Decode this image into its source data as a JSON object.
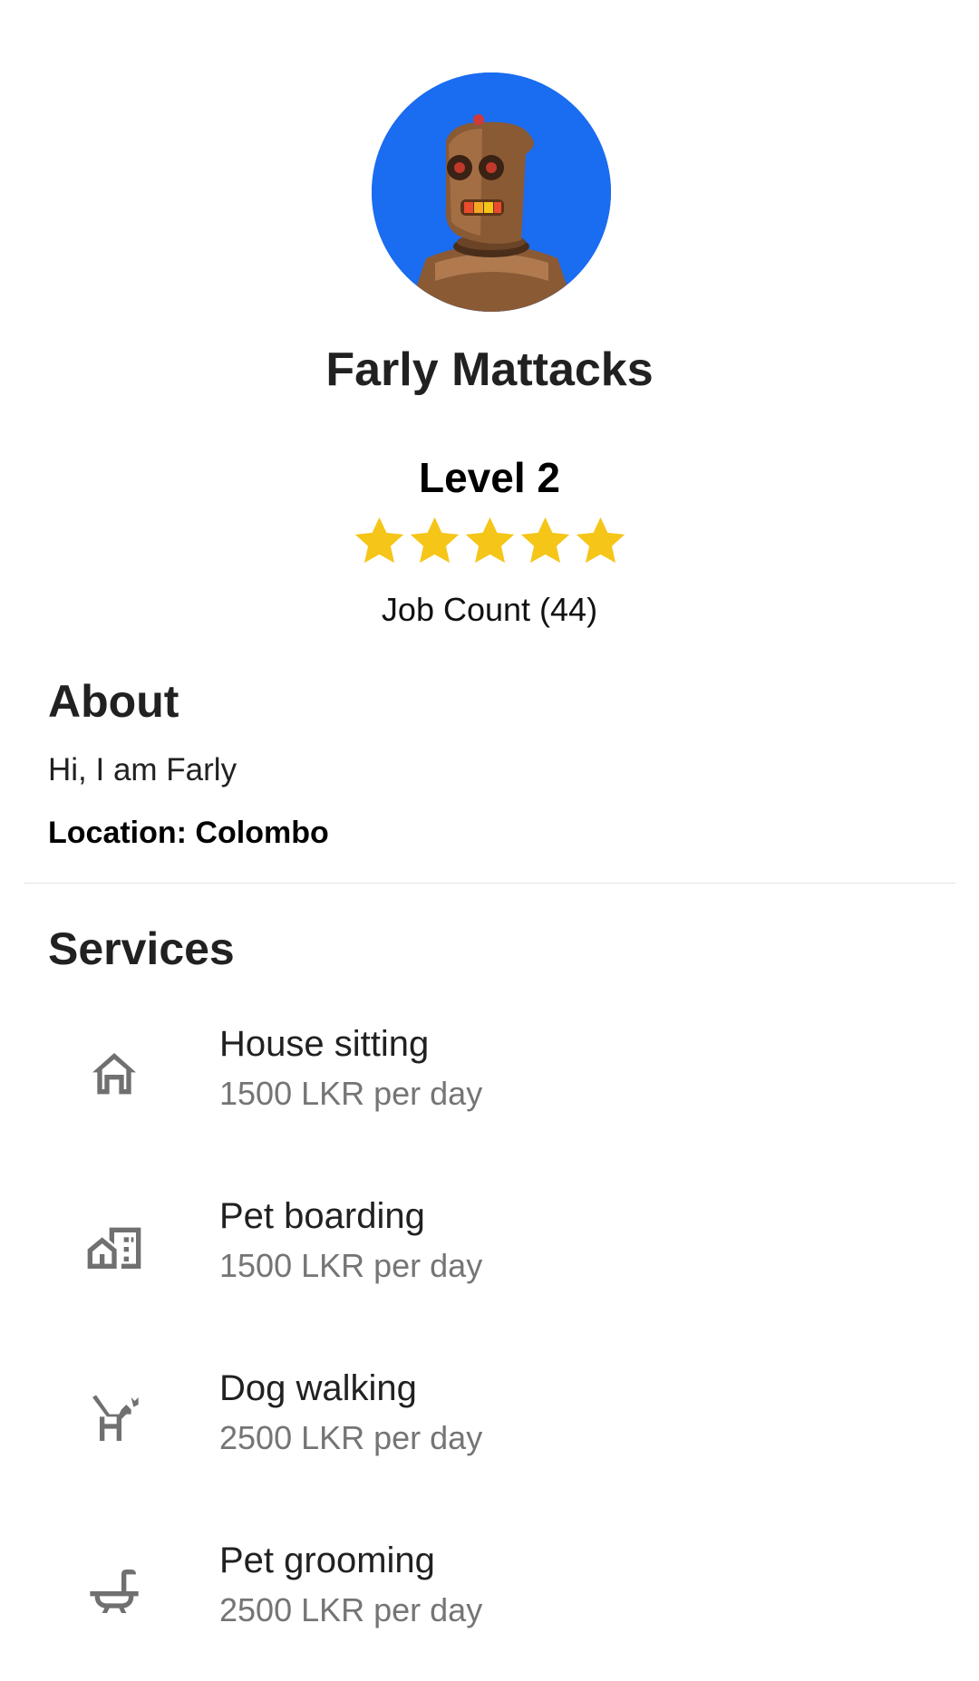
{
  "profile": {
    "name": "Farly Mattacks",
    "level": "Level 2",
    "rating": 5,
    "rating_max": 5,
    "job_count": "Job Count (44)",
    "avatar_bg": "#1a6cf0"
  },
  "about": {
    "heading": "About",
    "bio": "Hi, I am Farly",
    "location": "Location: Colombo"
  },
  "services": {
    "heading": "Services",
    "items": [
      {
        "title": "House sitting",
        "price": "1500 LKR per day",
        "icon": "house-icon"
      },
      {
        "title": "Pet boarding",
        "price": "1500 LKR per day",
        "icon": "boarding-building-icon"
      },
      {
        "title": "Dog walking",
        "price": "2500 LKR per day",
        "icon": "dog-icon"
      },
      {
        "title": "Pet grooming",
        "price": "2500 LKR per day",
        "icon": "bathtub-icon"
      }
    ]
  },
  "colors": {
    "star": "#f5c518",
    "icon": "#707070",
    "subtext": "#757575"
  }
}
